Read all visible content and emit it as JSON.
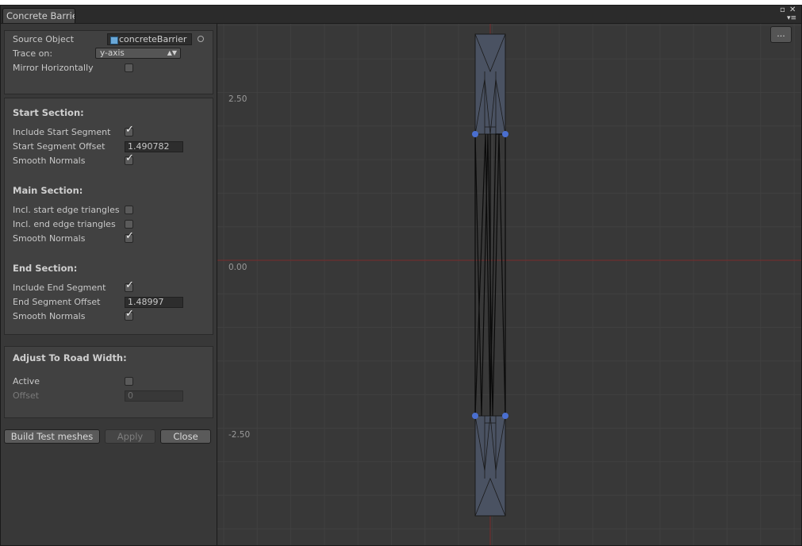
{
  "window": {
    "tab_title": "Concrete Barrier"
  },
  "source": {
    "source_object_label": "Source Object",
    "source_object_value": "concreteBarrier",
    "trace_on_label": "Trace on:",
    "trace_on_value": "y-axis",
    "mirror_label": "Mirror Horizontally",
    "mirror_checked": false
  },
  "start_section": {
    "heading": "Start Section:",
    "include_label": "Include Start Segment",
    "include_checked": true,
    "offset_label": "Start Segment Offset",
    "offset_value": "1.490782",
    "smooth_label": "Smooth Normals",
    "smooth_checked": true
  },
  "main_section": {
    "heading": "Main Section:",
    "start_edge_label": "Incl. start edge triangles",
    "start_edge_checked": false,
    "end_edge_label": "Incl. end edge triangles",
    "end_edge_checked": false,
    "smooth_label": "Smooth Normals",
    "smooth_checked": true
  },
  "end_section": {
    "heading": "End Section:",
    "include_label": "Include End Segment",
    "include_checked": true,
    "offset_label": "End Segment Offset",
    "offset_value": "1.48997",
    "smooth_label": "Smooth Normals",
    "smooth_checked": true
  },
  "road_width": {
    "heading": "Adjust To Road Width:",
    "active_label": "Active",
    "active_checked": false,
    "offset_label": "Offset",
    "offset_value": "0"
  },
  "buttons": {
    "build": "Build Test meshes",
    "apply": "Apply",
    "close": "Close"
  },
  "preview": {
    "more_label": "...",
    "axis_labels": [
      "2.50",
      "0.00",
      "-2.50"
    ],
    "colors": {
      "axis": "#7a2a2a",
      "mesh_fill": "#4a5262",
      "handle": "#4a6fd0",
      "grid": "#404040"
    }
  },
  "icons": {
    "maximize": "maximize-icon",
    "close": "close-icon",
    "menu": "menu-icon",
    "check": "check-icon"
  }
}
